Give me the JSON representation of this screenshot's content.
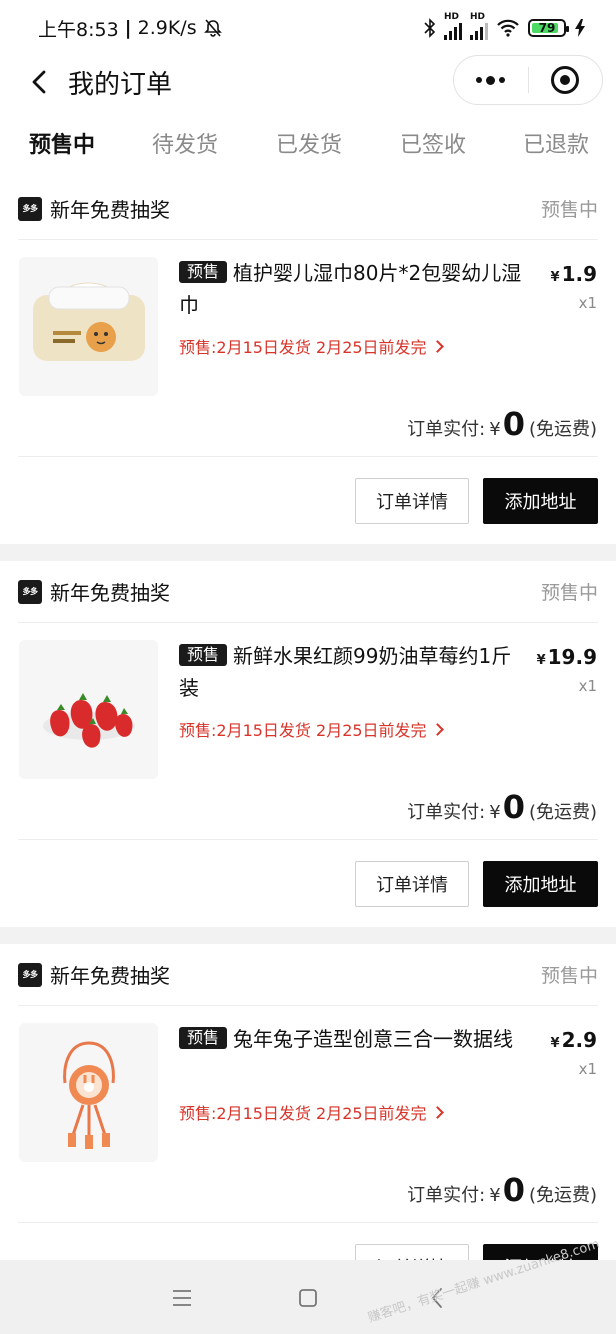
{
  "status_bar": {
    "time": "上午8:53",
    "separator": "|",
    "net_speed": "2.9K/s",
    "hd1": "HD",
    "hd2": "HD",
    "battery": "79"
  },
  "nav": {
    "title": "我的订单"
  },
  "tabs": [
    {
      "label": "预售中",
      "active": true
    },
    {
      "label": "待发货",
      "active": false
    },
    {
      "label": "已发货",
      "active": false
    },
    {
      "label": "已签收",
      "active": false
    },
    {
      "label": "已退款",
      "active": false
    }
  ],
  "orders": [
    {
      "shop_logo_text": "多多",
      "shop_name": "新年免费抽奖",
      "status": "预售中",
      "tag": "预售",
      "title": "植护婴儿湿巾80片*2包婴幼儿湿巾",
      "currency": "¥",
      "price": "1.9",
      "qty": "x1",
      "presale_note": "预售:2月15日发货 2月25日前发完",
      "paid_label": "订单实付:",
      "paid_currency": "¥",
      "paid_amount": "0",
      "shipping": "(免运费)",
      "detail_button": "订单详情",
      "address_button": "添加地址",
      "image": "wet-wipes-package"
    },
    {
      "shop_logo_text": "多多",
      "shop_name": "新年免费抽奖",
      "status": "预售中",
      "tag": "预售",
      "title": "新鲜水果红颜99奶油草莓约1斤装",
      "currency": "¥",
      "price": "19.9",
      "qty": "x1",
      "presale_note": "预售:2月15日发货 2月25日前发完",
      "paid_label": "订单实付:",
      "paid_currency": "¥",
      "paid_amount": "0",
      "shipping": "(免运费)",
      "detail_button": "订单详情",
      "address_button": "添加地址",
      "image": "strawberries-plate"
    },
    {
      "shop_logo_text": "多多",
      "shop_name": "新年免费抽奖",
      "status": "预售中",
      "tag": "预售",
      "title": "兔年兔子造型创意三合一数据线",
      "currency": "¥",
      "price": "2.9",
      "qty": "x1",
      "presale_note": "预售:2月15日发货 2月25日前发完",
      "paid_label": "订单实付:",
      "paid_currency": "¥",
      "paid_amount": "0",
      "shipping": "(免运费)",
      "detail_button": "订单详情",
      "address_button": "添加地址",
      "image": "rabbit-charging-cable"
    }
  ],
  "icons": {
    "back": "chevron-left-icon",
    "more": "more-dots-icon",
    "close": "target-circle-icon",
    "mute": "bell-off-icon",
    "bluetooth": "bluetooth-icon",
    "wifi": "wifi-icon",
    "charging": "bolt-icon",
    "sys_menu": "menu-icon",
    "sys_home": "square-icon",
    "sys_back": "triangle-back-icon"
  },
  "colors": {
    "accent_red": "#d8342a",
    "button_dark": "#0a0a0a",
    "battery_green": "#4cd964"
  },
  "watermark": "赚客吧，有奖一起赚 www.zuanke8.com"
}
